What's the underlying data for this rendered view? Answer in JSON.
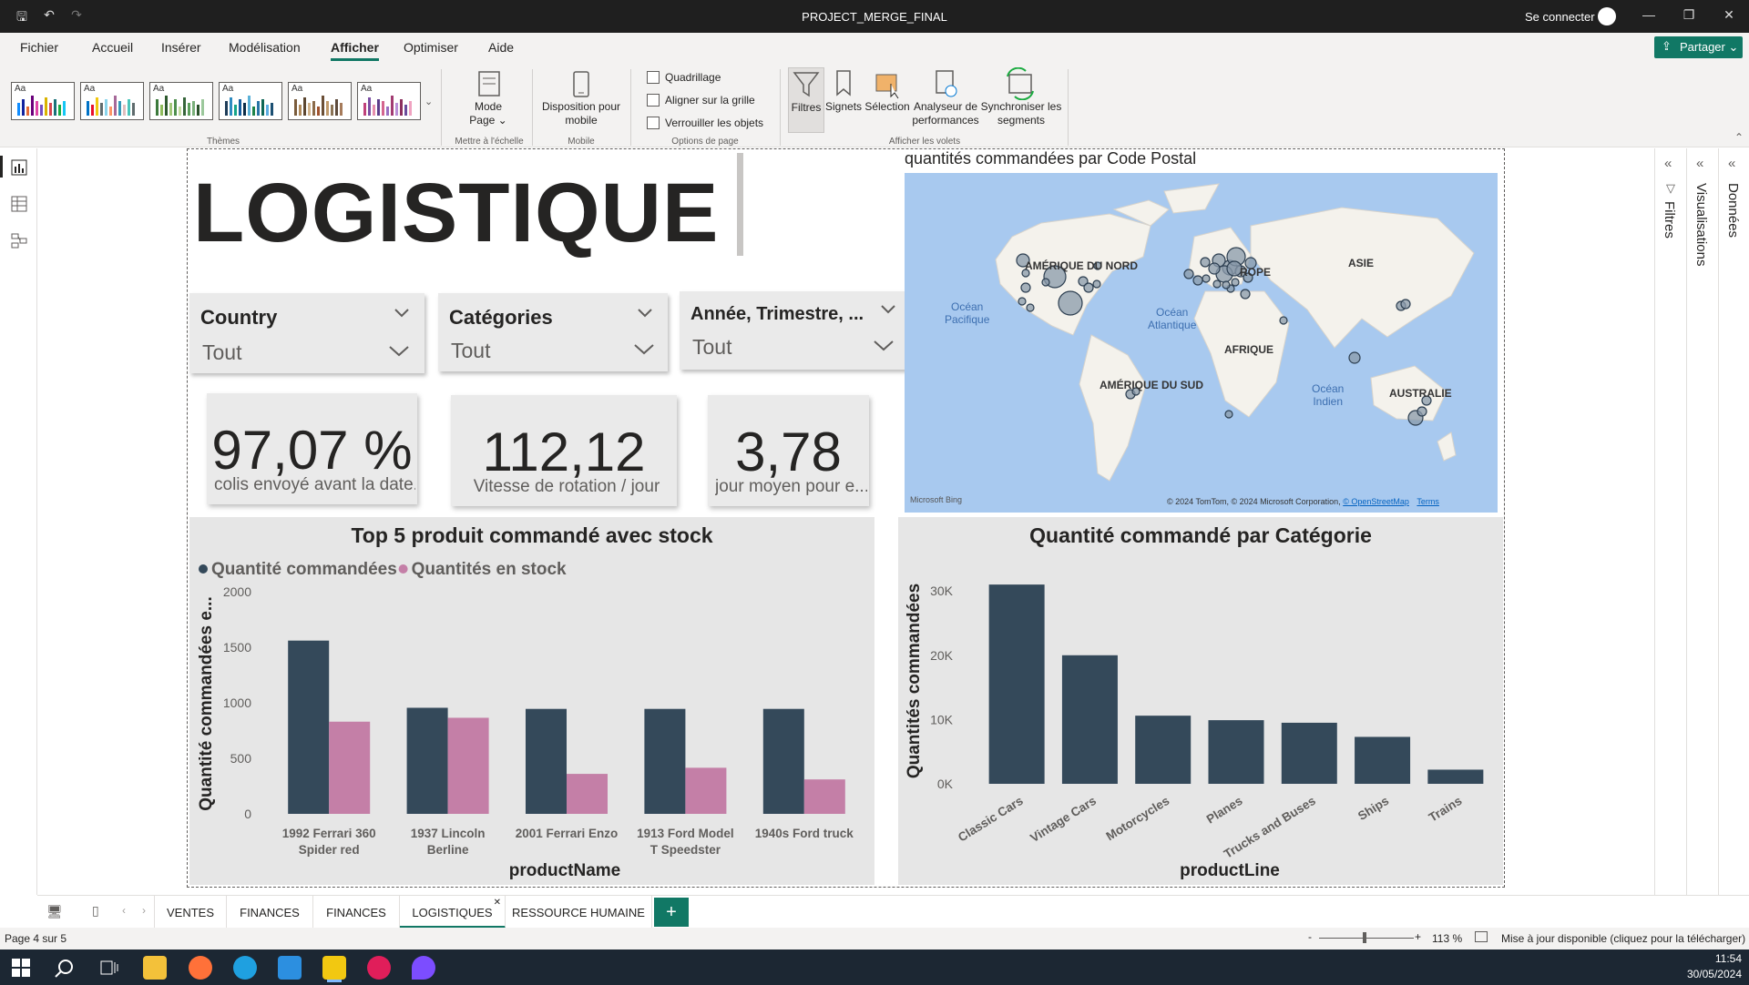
{
  "titlebar": {
    "title": "PROJECT_MERGE_FINAL",
    "signin": "Se connecter"
  },
  "menu": {
    "items": [
      "Fichier",
      "Accueil",
      "Insérer",
      "Modélisation",
      "Afficher",
      "Optimiser",
      "Aide"
    ],
    "active": "Afficher",
    "share": "Partager"
  },
  "ribbon": {
    "groups": {
      "themes": "Thèmes",
      "scale": "Mettre à l'échelle",
      "mobile": "Mobile",
      "page_options": "Options de page",
      "panes": "Afficher les volets"
    },
    "mode_page": [
      "Mode",
      "Page"
    ],
    "mobile_layout": [
      "Disposition pour",
      "mobile"
    ],
    "checkboxes": [
      "Quadrillage",
      "Aligner sur la grille",
      "Verrouiller les objets"
    ],
    "panes": [
      "Filtres",
      "Signets",
      "Sélection"
    ],
    "analyzer": [
      "Analyseur de",
      "performances"
    ],
    "sync": [
      "Synchroniser les",
      "segments"
    ],
    "theme_tiles": [
      "Aa",
      "Aa",
      "Aa",
      "Aa",
      "Aa",
      "Aa"
    ]
  },
  "report": {
    "title": "LOGISTIQUE",
    "slicers": [
      {
        "label": "Country",
        "value": "Tout"
      },
      {
        "label": "Catégories",
        "value": "Tout"
      },
      {
        "label": "Année, Trimestre, ...",
        "value": "Tout"
      }
    ],
    "cards": [
      {
        "value": "97,07 %",
        "caption": "colis envoyé avant la date..."
      },
      {
        "value": "112,12",
        "caption": "Vitesse de rotation / jour"
      },
      {
        "value": "3,78",
        "caption": "jour moyen pour e..."
      }
    ],
    "map": {
      "title": "quantités commandées par Code Postal",
      "labels": [
        "AMÉRIQUE DU NORD",
        "ROPE",
        "ASIE",
        "AFRIQUE",
        "AMÉRIQUE DU SUD",
        "AUSTRALIE",
        "Océan Pacifique",
        "Océan Atlantique",
        "Océan Indien"
      ],
      "ocean_pacific": [
        "Océan",
        "Pacifique"
      ],
      "ocean_atlantic": [
        "Océan",
        "Atlantique"
      ],
      "ocean_indian": [
        "Océan",
        "Indien"
      ],
      "attribution": "© 2024 TomTom, © 2024 Microsoft Corporation,",
      "osm": "© OpenStreetMap",
      "terms": "Terms",
      "brand": "Microsoft Bing"
    }
  },
  "chart_data": [
    {
      "type": "bar",
      "title": "Top 5 produit commandé avec stock",
      "xlabel": "productName",
      "ylabel": "Quantité commandées e...",
      "categories": [
        "1992 Ferrari 360 Spider red",
        "1937 Lincoln Berline",
        "2001 Ferrari Enzo",
        "1913 Ford Model T Speedster",
        "1940s Ford truck"
      ],
      "category_lines": [
        [
          "1992 Ferrari 360",
          "Spider red"
        ],
        [
          "1937 Lincoln",
          "Berline"
        ],
        [
          "2001 Ferrari Enzo"
        ],
        [
          "1913 Ford Model",
          "T Speedster"
        ],
        [
          "1940s Ford truck"
        ]
      ],
      "series": [
        {
          "name": "Quantité commandées",
          "values": [
            1560,
            955,
            945,
            945,
            945
          ],
          "color": "#34495a"
        },
        {
          "name": "Quantités en stock",
          "values": [
            830,
            865,
            360,
            415,
            310
          ],
          "color": "#c47fa7"
        }
      ],
      "ylim": [
        0,
        2000
      ],
      "yticks": [
        "0",
        "500",
        "1000",
        "1500",
        "2000"
      ],
      "legend": "top-left"
    },
    {
      "type": "bar",
      "title": "Quantité commandé par Catégorie",
      "xlabel": "productLine",
      "ylabel": "Quantités commandées",
      "categories": [
        "Classic Cars",
        "Vintage Cars",
        "Motorcycles",
        "Planes",
        "Trucks and Buses",
        "Ships",
        "Trains"
      ],
      "values": [
        31000,
        20000,
        10600,
        9900,
        9500,
        7300,
        2200
      ],
      "ylim": [
        0,
        33000
      ],
      "yticks": [
        "0K",
        "10K",
        "20K",
        "30K"
      ],
      "color": "#34495a"
    }
  ],
  "panes": {
    "filters": "Filtres",
    "visualizations": "Visualisations",
    "data": "Données"
  },
  "tabs": [
    "VENTES",
    "FINANCES",
    "FINANCES",
    "LOGISTIQUES",
    "RESSOURCE HUMAINE"
  ],
  "active_tab": "LOGISTIQUES",
  "status": {
    "page": "Page 4 sur 5",
    "zoom": "113 %",
    "update": "Mise à jour disponible (cliquez pour la télécharger)"
  },
  "taskbar": {
    "time": "11:54",
    "date": "30/05/2024"
  }
}
